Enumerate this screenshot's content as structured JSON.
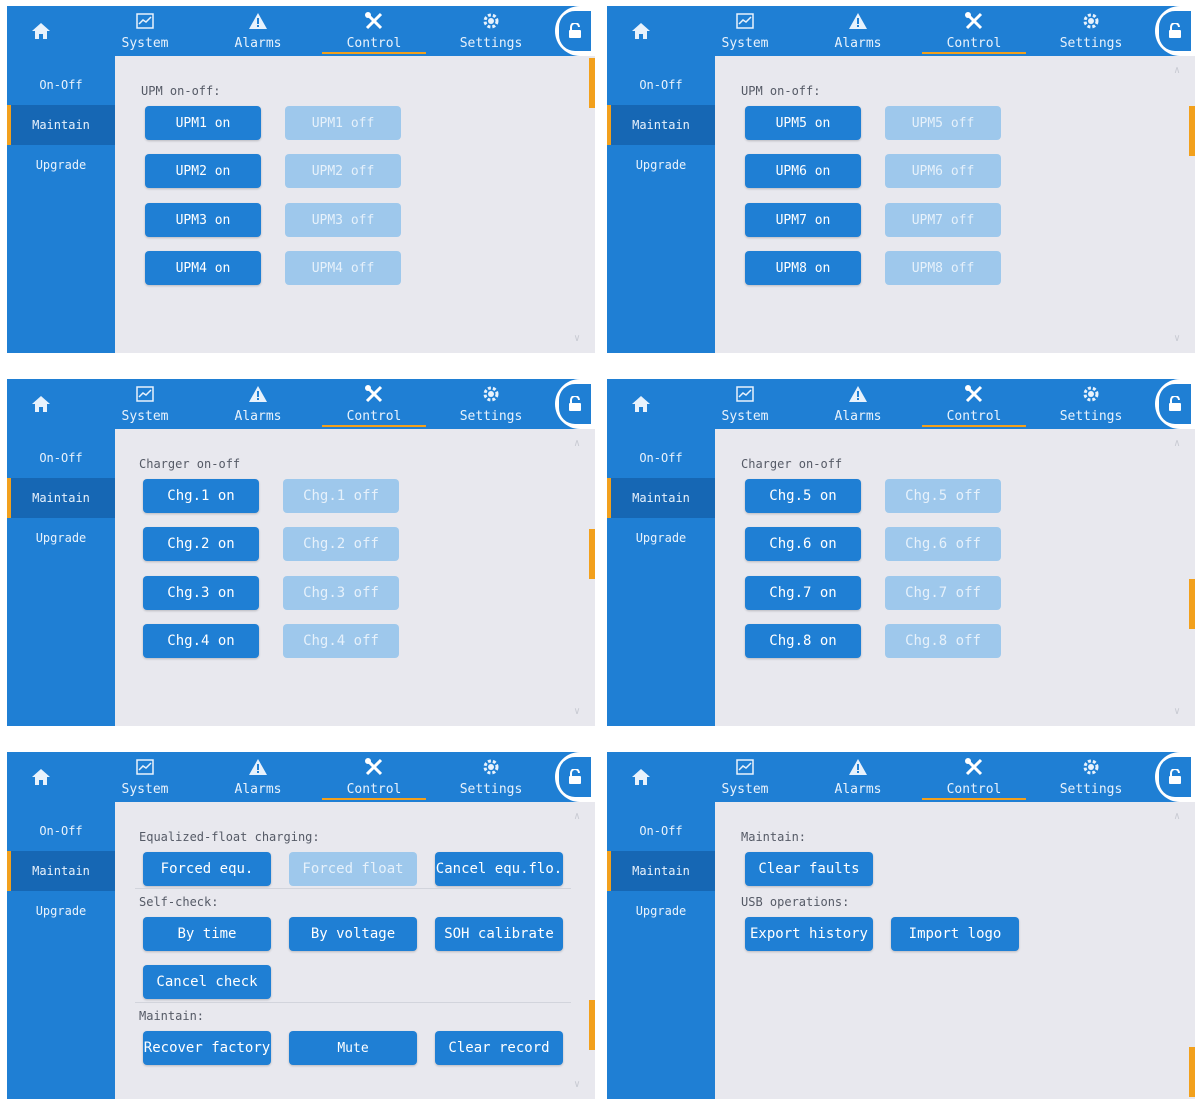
{
  "nav": {
    "tabs": [
      {
        "label": "System",
        "icon": "system-chart-icon"
      },
      {
        "label": "Alarms",
        "icon": "alarm-warning-icon"
      },
      {
        "label": "Control",
        "icon": "tools-icon"
      },
      {
        "label": "Settings",
        "icon": "gear-icon"
      }
    ],
    "active_tab": "Control",
    "sidebar": [
      "On-Off",
      "Maintain",
      "Upgrade"
    ],
    "active_sidebar": "Maintain"
  },
  "colors": {
    "primary": "#1f7fd4",
    "active_sidebar": "#1667b4",
    "accent": "#f2a01c",
    "disabled_button": "#9ec8ec",
    "content_bg": "#e8e8ee"
  },
  "screens": [
    {
      "section_label": "UPM on-off:",
      "on_buttons": [
        "UPM1 on",
        "UPM2 on",
        "UPM3 on",
        "UPM4 on"
      ],
      "off_buttons": [
        "UPM1 off",
        "UPM2 off",
        "UPM3 off",
        "UPM4 off"
      ]
    },
    {
      "section_label": "UPM on-off:",
      "on_buttons": [
        "UPM5 on",
        "UPM6 on",
        "UPM7 on",
        "UPM8 on"
      ],
      "off_buttons": [
        "UPM5 off",
        "UPM6 off",
        "UPM7 off",
        "UPM8 off"
      ]
    },
    {
      "section_label": "Charger on-off",
      "on_buttons": [
        "Chg.1 on",
        "Chg.2 on",
        "Chg.3 on",
        "Chg.4 on"
      ],
      "off_buttons": [
        "Chg.1 off",
        "Chg.2 off",
        "Chg.3 off",
        "Chg.4 off"
      ]
    },
    {
      "section_label": "Charger on-off",
      "on_buttons": [
        "Chg.5 on",
        "Chg.6 on",
        "Chg.7 on",
        "Chg.8 on"
      ],
      "off_buttons": [
        "Chg.5 off",
        "Chg.6 off",
        "Chg.7 off",
        "Chg.8 off"
      ]
    },
    {
      "equalize_label": "Equalized-float charging:",
      "forced_equ": "Forced equ.",
      "forced_float": "Forced float",
      "cancel_equ_flo": "Cancel equ.flo.",
      "selfcheck_label": "Self-check:",
      "by_time": "By time",
      "by_voltage": "By voltage",
      "soh_calibrate": "SOH calibrate",
      "cancel_check": "Cancel check",
      "maintain_label": "Maintain:",
      "recover_factory": "Recover factory",
      "mute": "Mute",
      "clear_record": "Clear record"
    },
    {
      "maintain_label": "Maintain:",
      "clear_faults": "Clear faults",
      "usb_label": "USB operations:",
      "export_history": "Export history",
      "import_logo": "Import logo"
    }
  ]
}
